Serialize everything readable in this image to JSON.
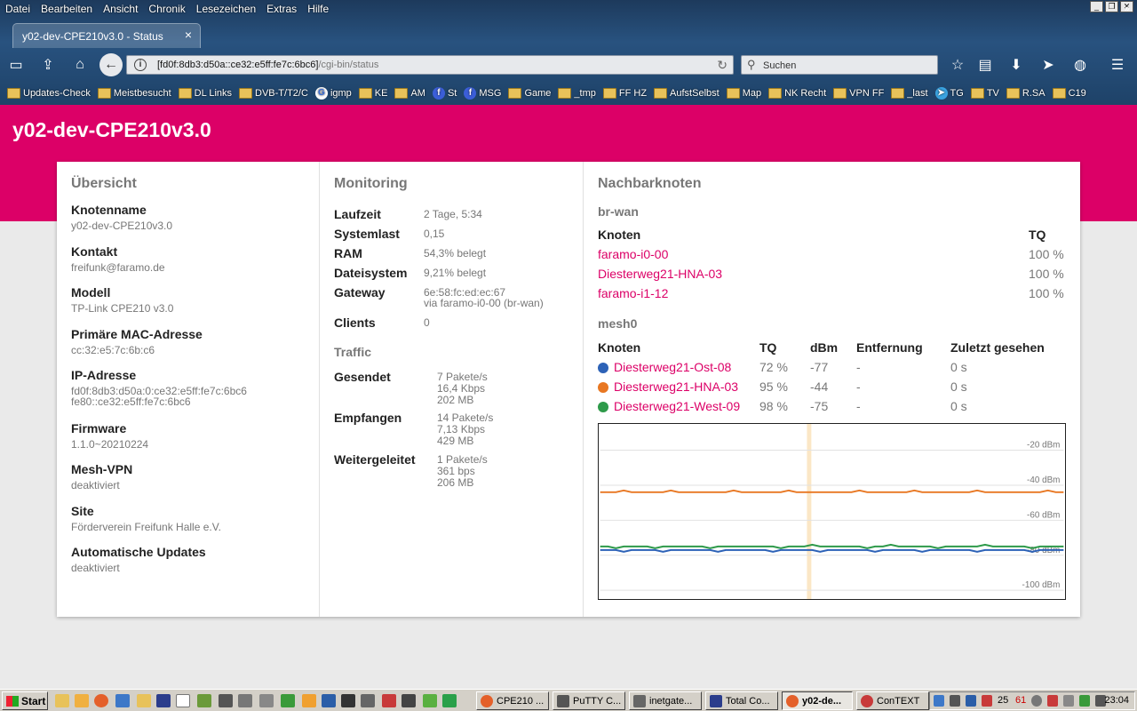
{
  "browser": {
    "menu": [
      "Datei",
      "Bearbeiten",
      "Ansicht",
      "Chronik",
      "Lesezeichen",
      "Extras",
      "Hilfe"
    ],
    "tab_title": "y02-dev-CPE210v3.0 - Status",
    "tab_close": "×",
    "url_host": "[fd0f:8db3:d50a::ce32:e5ff:fe7c:6bc6]",
    "url_path": "/cgi-bin/status",
    "search_placeholder": "Suchen",
    "bookmarks": [
      {
        "label": "Updates-Check",
        "icon": "folder-icon"
      },
      {
        "label": "Meistbesucht",
        "icon": "folder-icon"
      },
      {
        "label": "DL Links",
        "icon": "folder-icon"
      },
      {
        "label": "DVB-T/T2/C",
        "icon": "folder-icon"
      },
      {
        "label": "igmp",
        "icon": "google-icon"
      },
      {
        "label": "KE",
        "icon": "folder-icon"
      },
      {
        "label": "AM",
        "icon": "folder-icon"
      },
      {
        "label": "St",
        "icon": "facebook-icon"
      },
      {
        "label": "MSG",
        "icon": "facebook-icon"
      },
      {
        "label": "Game",
        "icon": "folder-icon"
      },
      {
        "label": "_tmp",
        "icon": "folder-icon"
      },
      {
        "label": "FF HZ",
        "icon": "folder-icon"
      },
      {
        "label": "AufstSelbst",
        "icon": "folder-icon"
      },
      {
        "label": "Map",
        "icon": "folder-icon"
      },
      {
        "label": "NK Recht",
        "icon": "folder-icon"
      },
      {
        "label": "VPN FF",
        "icon": "folder-icon"
      },
      {
        "label": "_last",
        "icon": "folder-icon"
      },
      {
        "label": "TG",
        "icon": "telegram-icon"
      },
      {
        "label": "TV",
        "icon": "folder-icon"
      },
      {
        "label": "R.SA",
        "icon": "folder-icon"
      },
      {
        "label": "C19",
        "icon": "folder-icon"
      }
    ],
    "bookmarks_more": "»"
  },
  "page": {
    "hostname": "y02-dev-CPE210v3.0",
    "overview": {
      "title": "Übersicht",
      "items": [
        {
          "label": "Knotenname",
          "value": "y02-dev-CPE210v3.0"
        },
        {
          "label": "Kontakt",
          "value": "freifunk@faramo.de"
        },
        {
          "label": "Modell",
          "value": "TP-Link CPE210 v3.0"
        },
        {
          "label": "Primäre MAC-Adresse",
          "value": "cc:32:e5:7c:6b:c6"
        },
        {
          "label": "IP-Adresse",
          "value": "fd0f:8db3:d50a:0:ce32:e5ff:fe7c:6bc6",
          "value2": "fe80::ce32:e5ff:fe7c:6bc6"
        },
        {
          "label": "Firmware",
          "value": "1.1.0~20210224"
        },
        {
          "label": "Mesh-VPN",
          "value": "deaktiviert"
        },
        {
          "label": "Site",
          "value": "Förderverein Freifunk Halle e.V."
        },
        {
          "label": "Automatische Updates",
          "value": "deaktiviert"
        }
      ]
    },
    "monitoring": {
      "title": "Monitoring",
      "items": [
        {
          "label": "Laufzeit",
          "value": "2 Tage, 5:34"
        },
        {
          "label": "Systemlast",
          "value": "0,15"
        },
        {
          "label": "RAM",
          "value": "54,3% belegt"
        },
        {
          "label": "Dateisystem",
          "value": "9,21% belegt"
        },
        {
          "label": "Gateway",
          "value": "6e:58:fc:ed:ec:67",
          "value2": "via faramo-i0-00 (br-wan)"
        },
        {
          "label": "Clients",
          "value": "0"
        }
      ],
      "traffic_title": "Traffic",
      "traffic": [
        {
          "label": "Gesendet",
          "lines": [
            "7 Pakete/s",
            "16,4 Kbps",
            "202 MB"
          ]
        },
        {
          "label": "Empfangen",
          "lines": [
            "14 Pakete/s",
            "7,13 Kbps",
            "429 MB"
          ]
        },
        {
          "label": "Weitergeleitet",
          "lines": [
            "1 Pakete/s",
            "361 bps",
            "206 MB"
          ]
        }
      ]
    },
    "neighbours": {
      "title": "Nachbarknoten",
      "brwan": {
        "title": "br-wan",
        "headers": [
          "Knoten",
          "TQ"
        ],
        "rows": [
          {
            "node": "faramo-i0-00",
            "tq": "100 %"
          },
          {
            "node": "Diesterweg21-HNA-03",
            "tq": "100 %"
          },
          {
            "node": "faramo-i1-12",
            "tq": "100 %"
          }
        ]
      },
      "mesh": {
        "title": "mesh0",
        "headers": [
          "Knoten",
          "TQ",
          "dBm",
          "Entfernung",
          "Zuletzt gesehen"
        ],
        "rows": [
          {
            "node": "Diesterweg21-Ost-08",
            "tq": "72 %",
            "dbm": "-77",
            "dist": "-",
            "seen": "0 s",
            "color": "#2d62b7"
          },
          {
            "node": "Diesterweg21-HNA-03",
            "tq": "95 %",
            "dbm": "-44",
            "dist": "-",
            "seen": "0 s",
            "color": "#e87722"
          },
          {
            "node": "Diesterweg21-West-09",
            "tq": "98 %",
            "dbm": "-75",
            "dist": "-",
            "seen": "0 s",
            "color": "#2e9a4a"
          }
        ]
      }
    }
  },
  "chart_data": {
    "type": "line",
    "title": "",
    "xlabel": "",
    "ylabel": "",
    "y_ticks": [
      "-20 dBm",
      "-40 dBm",
      "-60 dBm",
      "-80 dBm",
      "-100 dBm"
    ],
    "y_tick_values": [
      -20,
      -40,
      -60,
      -80,
      -100
    ],
    "ylim": [
      -105,
      -5
    ],
    "grid": true,
    "highlight_marker_fraction": 0.45,
    "series": [
      {
        "values": [
          -44,
          -44,
          -44,
          -43,
          -44,
          -44,
          -44,
          -44,
          -44,
          -43,
          -44,
          -44,
          -44,
          -44,
          -44,
          -44,
          -44,
          -43,
          -44,
          -44,
          -44,
          -44,
          -44,
          -44,
          -43,
          -44,
          -44,
          -44,
          -44,
          -44,
          -44,
          -44,
          -44,
          -43,
          -44,
          -44,
          -44,
          -44,
          -44,
          -44,
          -43,
          -44,
          -44,
          -44,
          -44,
          -44,
          -44,
          -44,
          -43,
          -44,
          -44,
          -44,
          -44,
          -44,
          -44,
          -44,
          -44,
          -43,
          -44,
          -44
        ],
        "color": "#e87722"
      },
      {
        "values": [
          -75,
          -75,
          -76,
          -75,
          -75,
          -75,
          -75,
          -76,
          -75,
          -75,
          -75,
          -75,
          -75,
          -75,
          -76,
          -75,
          -75,
          -75,
          -75,
          -75,
          -75,
          -75,
          -75,
          -76,
          -75,
          -75,
          -75,
          -74,
          -75,
          -75,
          -75,
          -75,
          -75,
          -75,
          -76,
          -75,
          -75,
          -74,
          -75,
          -75,
          -75,
          -75,
          -75,
          -76,
          -75,
          -75,
          -75,
          -75,
          -75,
          -74,
          -75,
          -75,
          -75,
          -75,
          -75,
          -76,
          -75,
          -75,
          -75,
          -75
        ],
        "color": "#2e9a4a"
      },
      {
        "values": [
          -77,
          -77,
          -77,
          -78,
          -77,
          -77,
          -77,
          -77,
          -78,
          -77,
          -77,
          -77,
          -77,
          -77,
          -77,
          -78,
          -77,
          -77,
          -77,
          -77,
          -77,
          -77,
          -78,
          -77,
          -77,
          -77,
          -77,
          -77,
          -78,
          -77,
          -77,
          -77,
          -77,
          -77,
          -77,
          -78,
          -77,
          -77,
          -77,
          -77,
          -77,
          -78,
          -77,
          -77,
          -77,
          -77,
          -77,
          -77,
          -78,
          -77,
          -77,
          -77,
          -77,
          -77,
          -77,
          -78,
          -77,
          -77,
          -77,
          -77
        ],
        "color": "#2d62b7"
      }
    ]
  },
  "taskbar": {
    "start": "Start",
    "tasks": [
      "CPE210 ...",
      "PuTTY C...",
      "inetgate...",
      "Total Co...",
      "y02-de...",
      "ConTEXT"
    ],
    "tray_num1": "25",
    "tray_num2": "61",
    "clock": "23:04"
  }
}
